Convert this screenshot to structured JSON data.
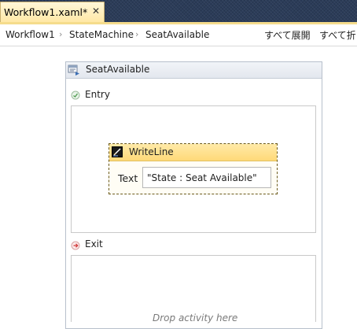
{
  "tab": {
    "title": "Workflow1.xaml*",
    "close_glyph": "✕"
  },
  "breadcrumb": [
    {
      "label": "Workflow1"
    },
    {
      "label": "StateMachine"
    },
    {
      "label": "SeatAvailable"
    }
  ],
  "breadcrumb_separator": "›",
  "toolbar": {
    "expand_all": "すべて展開",
    "collapse_all": "すべて折"
  },
  "state": {
    "title": "SeatAvailable",
    "icon": "state-icon",
    "entry": {
      "label": "Entry",
      "icon": "entry-icon"
    },
    "exit": {
      "label": "Exit",
      "icon": "exit-icon"
    }
  },
  "activity": {
    "title": "WriteLine",
    "icon": "writeline-icon",
    "property_label": "Text",
    "property_value": "\"State : Seat Available\""
  },
  "exit_drop_hint": "Drop activity here",
  "colors": {
    "tabstrip": "#2b3c59",
    "tab_active": "#ffe8a6",
    "accent_gold": "#f5dc8c",
    "activity_header": "#ffd978"
  }
}
